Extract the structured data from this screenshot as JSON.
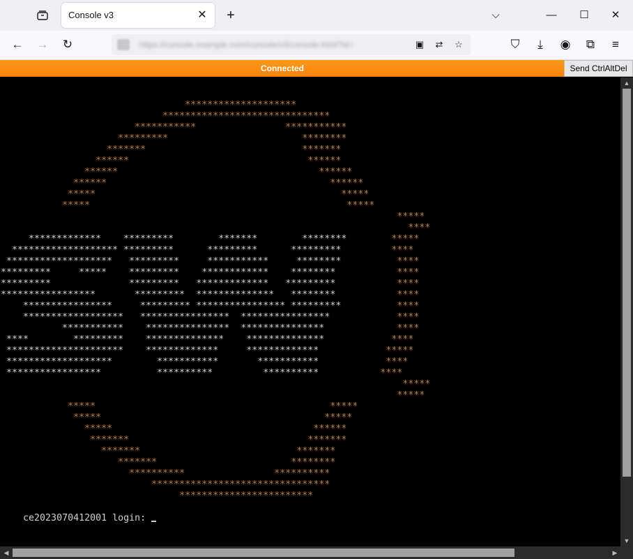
{
  "browser": {
    "tab_title": "Console v3",
    "tab_close": "✕",
    "new_tab": "+",
    "tab_list_icon": "▭",
    "window": {
      "list_all_tabs": "⌵",
      "minimize": "—",
      "maximize": "☐",
      "close": "✕"
    },
    "nav": {
      "back": "←",
      "forward": "→",
      "reload": "↻"
    },
    "url": {
      "text": "https://console.example.com/console/v3/console.html?id=",
      "site_icon": "site-identity-icon"
    },
    "url_icons": {
      "reader": "▣",
      "translate": "⇄",
      "bookmark": "☆"
    },
    "toolbar_icons": {
      "pocket": "⛉",
      "downloads": "⤓",
      "account": "◉",
      "extensions": "⧉",
      "menu": "≡"
    }
  },
  "console": {
    "status": "Connected",
    "status_color": "#f7820c",
    "send_cad_label": "Send CtrlAltDel",
    "login_prompt": "ce2023070412001 login: ",
    "logo_lines": [
      [
        [
          "                                 ",
          "w"
        ],
        [
          "********************",
          "o"
        ]
      ],
      [
        [
          "                             ",
          "w"
        ],
        [
          "******************************",
          "o"
        ]
      ],
      [
        [
          "                        ",
          "w"
        ],
        [
          "***********",
          "o"
        ],
        [
          "                ",
          "w"
        ],
        [
          "***********",
          "o"
        ]
      ],
      [
        [
          "                     ",
          "w"
        ],
        [
          "*********",
          "o"
        ],
        [
          "                        ",
          "w"
        ],
        [
          "********",
          "o"
        ]
      ],
      [
        [
          "                   ",
          "w"
        ],
        [
          "*******",
          "o"
        ],
        [
          "                            ",
          "w"
        ],
        [
          "*******",
          "o"
        ]
      ],
      [
        [
          "                 ",
          "w"
        ],
        [
          "******",
          "o"
        ],
        [
          "                                ",
          "w"
        ],
        [
          "******",
          "o"
        ]
      ],
      [
        [
          "               ",
          "w"
        ],
        [
          "******",
          "o"
        ],
        [
          "                                    ",
          "w"
        ],
        [
          "******",
          "o"
        ]
      ],
      [
        [
          "             ",
          "w"
        ],
        [
          "******",
          "o"
        ],
        [
          "                                        ",
          "w"
        ],
        [
          "******",
          "o"
        ]
      ],
      [
        [
          "            ",
          "w"
        ],
        [
          "*****",
          "o"
        ],
        [
          "                                            ",
          "w"
        ],
        [
          "*****",
          "o"
        ]
      ],
      [
        [
          "           ",
          "w"
        ],
        [
          "*****",
          "o"
        ],
        [
          "                                              ",
          "w"
        ],
        [
          "*****",
          "o"
        ]
      ],
      [
        [
          "                                                                       ",
          "w"
        ],
        [
          "*****",
          "o"
        ]
      ],
      [
        [
          "                                                                         ",
          "w"
        ],
        [
          "****",
          "o"
        ]
      ],
      [
        [
          "     *************    *********        *******        ********        ",
          "w"
        ],
        [
          "*****",
          "o"
        ]
      ],
      [
        [
          "  ******************* *********      *********      *********         ",
          "w"
        ],
        [
          "****",
          "o"
        ]
      ],
      [
        [
          " *******************   *********     ***********     ********          ",
          "w"
        ],
        [
          "****",
          "o"
        ]
      ],
      [
        [
          "*********     *****    *********    ************    ********           ",
          "w"
        ],
        [
          "****",
          "o"
        ]
      ],
      [
        [
          "*********              *********   *************   *********           ",
          "w"
        ],
        [
          "****",
          "o"
        ]
      ],
      [
        [
          "*****************       *********  **************   ********           ",
          "w"
        ],
        [
          "****",
          "o"
        ]
      ],
      [
        [
          "    ****************     ********* **************** *********          ",
          "w"
        ],
        [
          "****",
          "o"
        ]
      ],
      [
        [
          "    ******************   ****************  ****************            ",
          "w"
        ],
        [
          "****",
          "o"
        ]
      ],
      [
        [
          "           ***********    ***************  ***************             ",
          "w"
        ],
        [
          "****",
          "o"
        ]
      ],
      [
        [
          " ****        *********    **************    **************            ",
          "w"
        ],
        [
          "****",
          "o"
        ]
      ],
      [
        [
          " *********************    *************     *************            ",
          "w"
        ],
        [
          "*****",
          "o"
        ]
      ],
      [
        [
          " *******************        ***********       ***********            ",
          "w"
        ],
        [
          "****",
          "o"
        ]
      ],
      [
        [
          " *****************          **********         **********           ",
          "w"
        ],
        [
          "****",
          "o"
        ]
      ],
      [
        [
          "                                                                        ",
          "w"
        ],
        [
          "*****",
          "o"
        ]
      ],
      [
        [
          "                                                                       ",
          "w"
        ],
        [
          "*****",
          "o"
        ]
      ],
      [
        [
          "            ",
          "w"
        ],
        [
          "*****",
          "o"
        ],
        [
          "                                          ",
          "w"
        ],
        [
          "*****",
          "o"
        ]
      ],
      [
        [
          "             ",
          "w"
        ],
        [
          "*****",
          "o"
        ],
        [
          "                                        ",
          "w"
        ],
        [
          "*****",
          "o"
        ]
      ],
      [
        [
          "               ",
          "w"
        ],
        [
          "*****",
          "o"
        ],
        [
          "                                    ",
          "w"
        ],
        [
          "******",
          "o"
        ]
      ],
      [
        [
          "                ",
          "w"
        ],
        [
          "*******",
          "o"
        ],
        [
          "                                ",
          "w"
        ],
        [
          "*******",
          "o"
        ]
      ],
      [
        [
          "                  ",
          "w"
        ],
        [
          "*******",
          "o"
        ],
        [
          "                            ",
          "w"
        ],
        [
          "*******",
          "o"
        ]
      ],
      [
        [
          "                     ",
          "w"
        ],
        [
          "*******",
          "o"
        ],
        [
          "                        ",
          "w"
        ],
        [
          "********",
          "o"
        ]
      ],
      [
        [
          "                       ",
          "w"
        ],
        [
          "**********",
          "o"
        ],
        [
          "                ",
          "w"
        ],
        [
          "**********",
          "o"
        ]
      ],
      [
        [
          "                           ",
          "w"
        ],
        [
          "********************************",
          "o"
        ]
      ],
      [
        [
          "                                ",
          "w"
        ],
        [
          "************************",
          "o"
        ]
      ]
    ]
  }
}
